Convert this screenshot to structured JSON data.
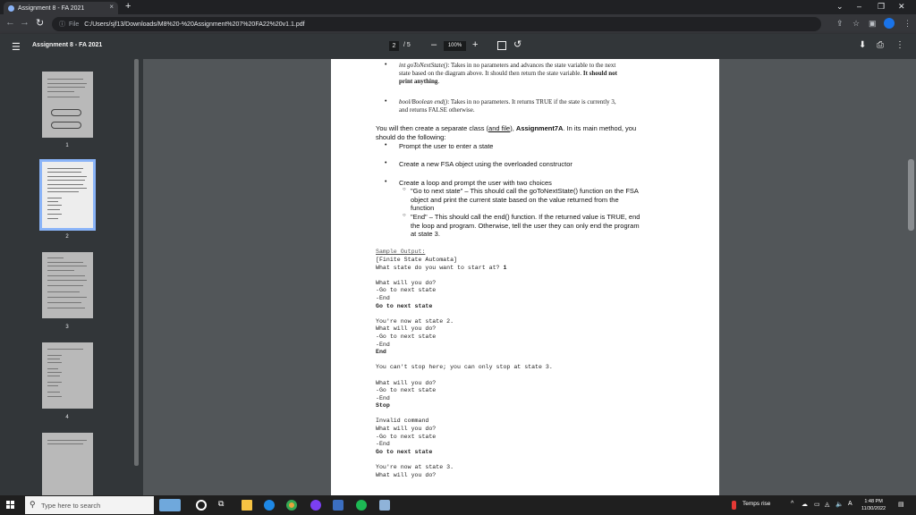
{
  "browser": {
    "tab_title": "Assignment 8 - FA 2021",
    "tab_close": "×",
    "new_tab": "+",
    "url_prefix": "File",
    "url": "C:/Users/sjf13/Downloads/M8%20-%20Assignment%207%20FA22%20v1.1.pdf"
  },
  "pdf_toolbar": {
    "title": "Assignment 8 - FA 2021",
    "current_page": "2",
    "page_sep": "/  5",
    "zoom": "100%"
  },
  "thumbnails": [
    {
      "number": "1"
    },
    {
      "number": "2",
      "selected": true
    },
    {
      "number": "3"
    },
    {
      "number": "4"
    },
    {
      "number": ""
    }
  ],
  "document": {
    "bullet1_func": "int goToNextState()",
    "bullet1_text": ": Takes in no parameters and advances the state variable to the next",
    "bullet1_line2": "state based on the diagram above. It should then return the state variable.",
    "bullet1_bold": " It should not",
    "bullet1_line3": "print anything",
    "bullet1_end": ".",
    "bullet2_func": "bool/Boolean end()",
    "bullet2_text": ": Takes in no parameters. It returns TRUE if the state is currently 3,",
    "bullet2_line2": "and returns FALSE otherwise.",
    "para_line1_a": "You will then create a separate class (",
    "para_line1_link": "and file",
    "para_line1_b": "), ",
    "para_line1_bold": "Assignment7A",
    "para_line1_c": ". In its main method, you",
    "para_line2": "should do the following:",
    "step1": "Prompt the user to enter a state",
    "step2": "Create a new FSA object using the overloaded constructor",
    "step3": "Create a loop and prompt the user with two choices",
    "sub1_l1": "\"Go to next state\" – This should call the goToNextState() function on the FSA",
    "sub1_l2": "object and print the current state based on the value returned from the",
    "sub1_l3": "function",
    "sub2_l1": "\"End\" – This should call the end() function. If the returned value is TRUE, end",
    "sub2_l2": "the loop and program. Otherwise, tell the user they can only end the program",
    "sub2_l3": "at state 3.",
    "sample_header": "Sample Output:",
    "output_lines": [
      {
        "text": "[Finite State Automata]",
        "bold": false
      },
      {
        "text": "What state do you want to start at? ",
        "bold_tail": "1"
      },
      {
        "text": "",
        "bold": false
      },
      {
        "text": "What will you do?",
        "bold": false
      },
      {
        "text": "-Go to next state",
        "bold": false
      },
      {
        "text": "-End",
        "bold": false
      },
      {
        "text": "Go to next state",
        "bold": true
      },
      {
        "text": "",
        "bold": false
      },
      {
        "text": "You're now at state 2.",
        "bold": false
      },
      {
        "text": "What will you do?",
        "bold": false
      },
      {
        "text": "-Go to next state",
        "bold": false
      },
      {
        "text": "-End",
        "bold": false
      },
      {
        "text": "End",
        "bold": true
      },
      {
        "text": "",
        "bold": false
      },
      {
        "text": "You can't stop here; you can only stop at state 3.",
        "bold": false
      },
      {
        "text": "",
        "bold": false
      },
      {
        "text": "What will you do?",
        "bold": false
      },
      {
        "text": "-Go to next state",
        "bold": false
      },
      {
        "text": "-End",
        "bold": false
      },
      {
        "text": "Stop",
        "bold": true
      },
      {
        "text": "",
        "bold": false
      },
      {
        "text": "Invalid command",
        "bold": false
      },
      {
        "text": "What will you do?",
        "bold": false
      },
      {
        "text": "-Go to next state",
        "bold": false
      },
      {
        "text": "-End",
        "bold": false
      },
      {
        "text": "Go to next state",
        "bold": true
      },
      {
        "text": "",
        "bold": false
      },
      {
        "text": "You're now at state 3.",
        "bold": false
      },
      {
        "text": "What will you do?",
        "bold": false
      }
    ]
  },
  "taskbar": {
    "search_placeholder": "Type here to search",
    "weather": "Temps rise",
    "time": "1:48 PM",
    "date": "11/30/2022"
  },
  "colors": {
    "chrome_dark": "#202124",
    "pdf_toolbar": "#323639",
    "doc_background": "#525659",
    "thumb_selected": "#8ab4f8"
  }
}
